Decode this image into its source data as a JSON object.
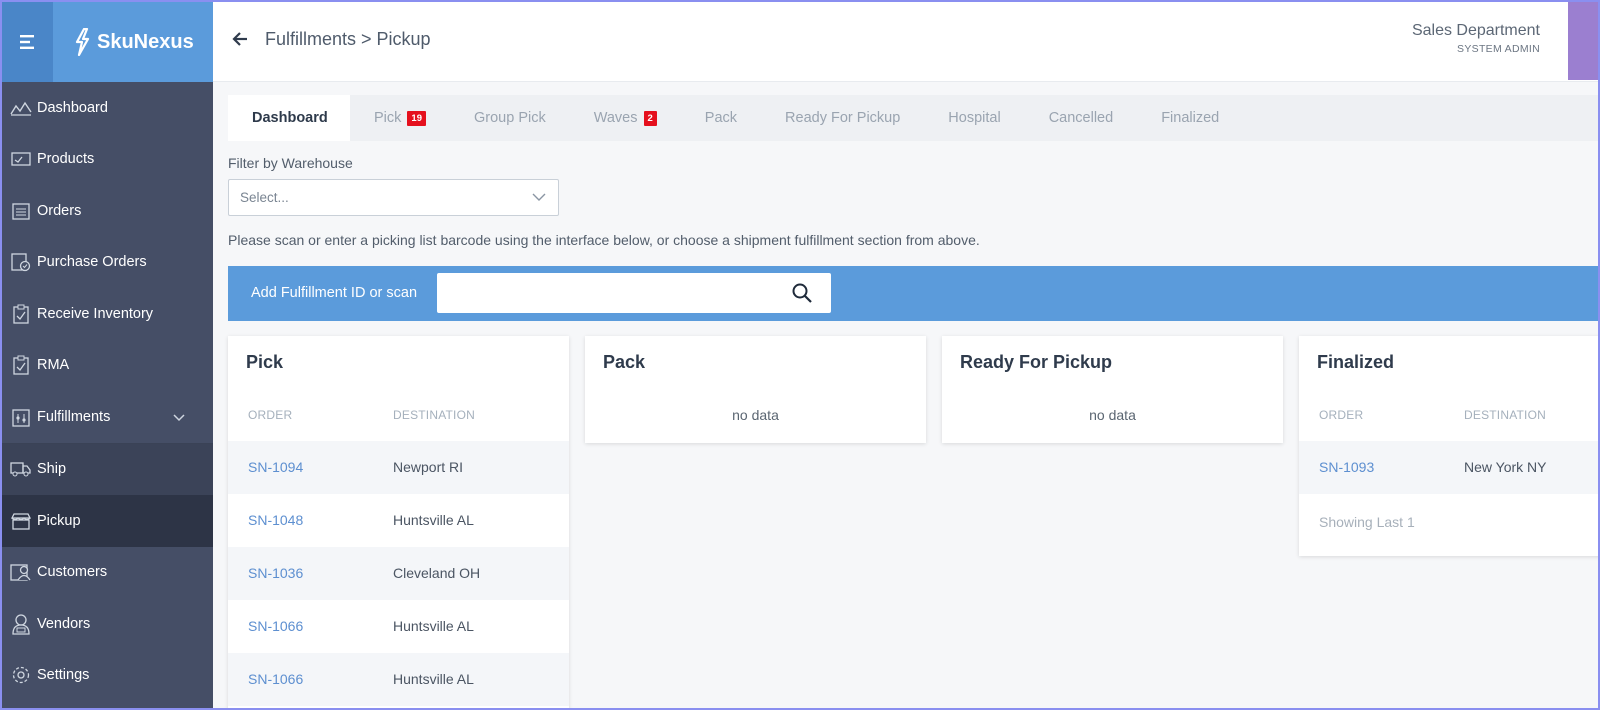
{
  "brand": {
    "name": "SkuNexus"
  },
  "header": {
    "breadcrumb": "Fulfillments > Pickup",
    "department": "Sales Department",
    "role": "SYSTEM ADMIN"
  },
  "sidebar": {
    "items": [
      {
        "label": "Dashboard",
        "icon": "chart-icon"
      },
      {
        "label": "Products",
        "icon": "product-icon"
      },
      {
        "label": "Orders",
        "icon": "orders-icon"
      },
      {
        "label": "Purchase Orders",
        "icon": "purchase-orders-icon"
      },
      {
        "label": "Receive Inventory",
        "icon": "clipboard-icon"
      },
      {
        "label": "RMA",
        "icon": "rma-icon"
      },
      {
        "label": "Fulfillments",
        "icon": "fulfillments-icon"
      },
      {
        "label": "Ship",
        "icon": "truck-icon"
      },
      {
        "label": "Pickup",
        "icon": "store-icon"
      },
      {
        "label": "Customers",
        "icon": "customers-icon"
      },
      {
        "label": "Vendors",
        "icon": "vendors-icon"
      },
      {
        "label": "Settings",
        "icon": "gear-icon"
      }
    ]
  },
  "tabs": [
    {
      "label": "Dashboard"
    },
    {
      "label": "Pick",
      "badge": "19"
    },
    {
      "label": "Group Pick"
    },
    {
      "label": "Waves",
      "badge": "2"
    },
    {
      "label": "Pack"
    },
    {
      "label": "Ready For Pickup"
    },
    {
      "label": "Hospital"
    },
    {
      "label": "Cancelled"
    },
    {
      "label": "Finalized"
    }
  ],
  "filter": {
    "label": "Filter by Warehouse",
    "placeholder": "Select..."
  },
  "hint": "Please scan or enter a picking list barcode using the interface below, or choose a shipment fulfillment section from above.",
  "scan": {
    "label": "Add Fulfillment ID or scan",
    "value": ""
  },
  "cards": {
    "pick": {
      "title": "Pick",
      "col_order": "ORDER",
      "col_destination": "DESTINATION",
      "rows": [
        {
          "order": "SN-1094",
          "destination": "Newport RI"
        },
        {
          "order": "SN-1048",
          "destination": "Huntsville AL"
        },
        {
          "order": "SN-1036",
          "destination": "Cleveland OH"
        },
        {
          "order": "SN-1066",
          "destination": "Huntsville AL"
        },
        {
          "order": "SN-1066",
          "destination": "Huntsville AL"
        }
      ]
    },
    "pack": {
      "title": "Pack",
      "empty": "no data"
    },
    "ready": {
      "title": "Ready For Pickup",
      "empty": "no data"
    },
    "finalized": {
      "title": "Finalized",
      "col_order": "ORDER",
      "col_destination": "DESTINATION",
      "rows": [
        {
          "order": "SN-1093",
          "destination": "New York NY"
        }
      ],
      "showing": "Showing Last 1"
    }
  },
  "colors": {
    "accent_blue": "#5b9bdb",
    "sidebar": "#454e66",
    "badge_red": "#e5101d",
    "link_blue": "#5d8fd0"
  }
}
